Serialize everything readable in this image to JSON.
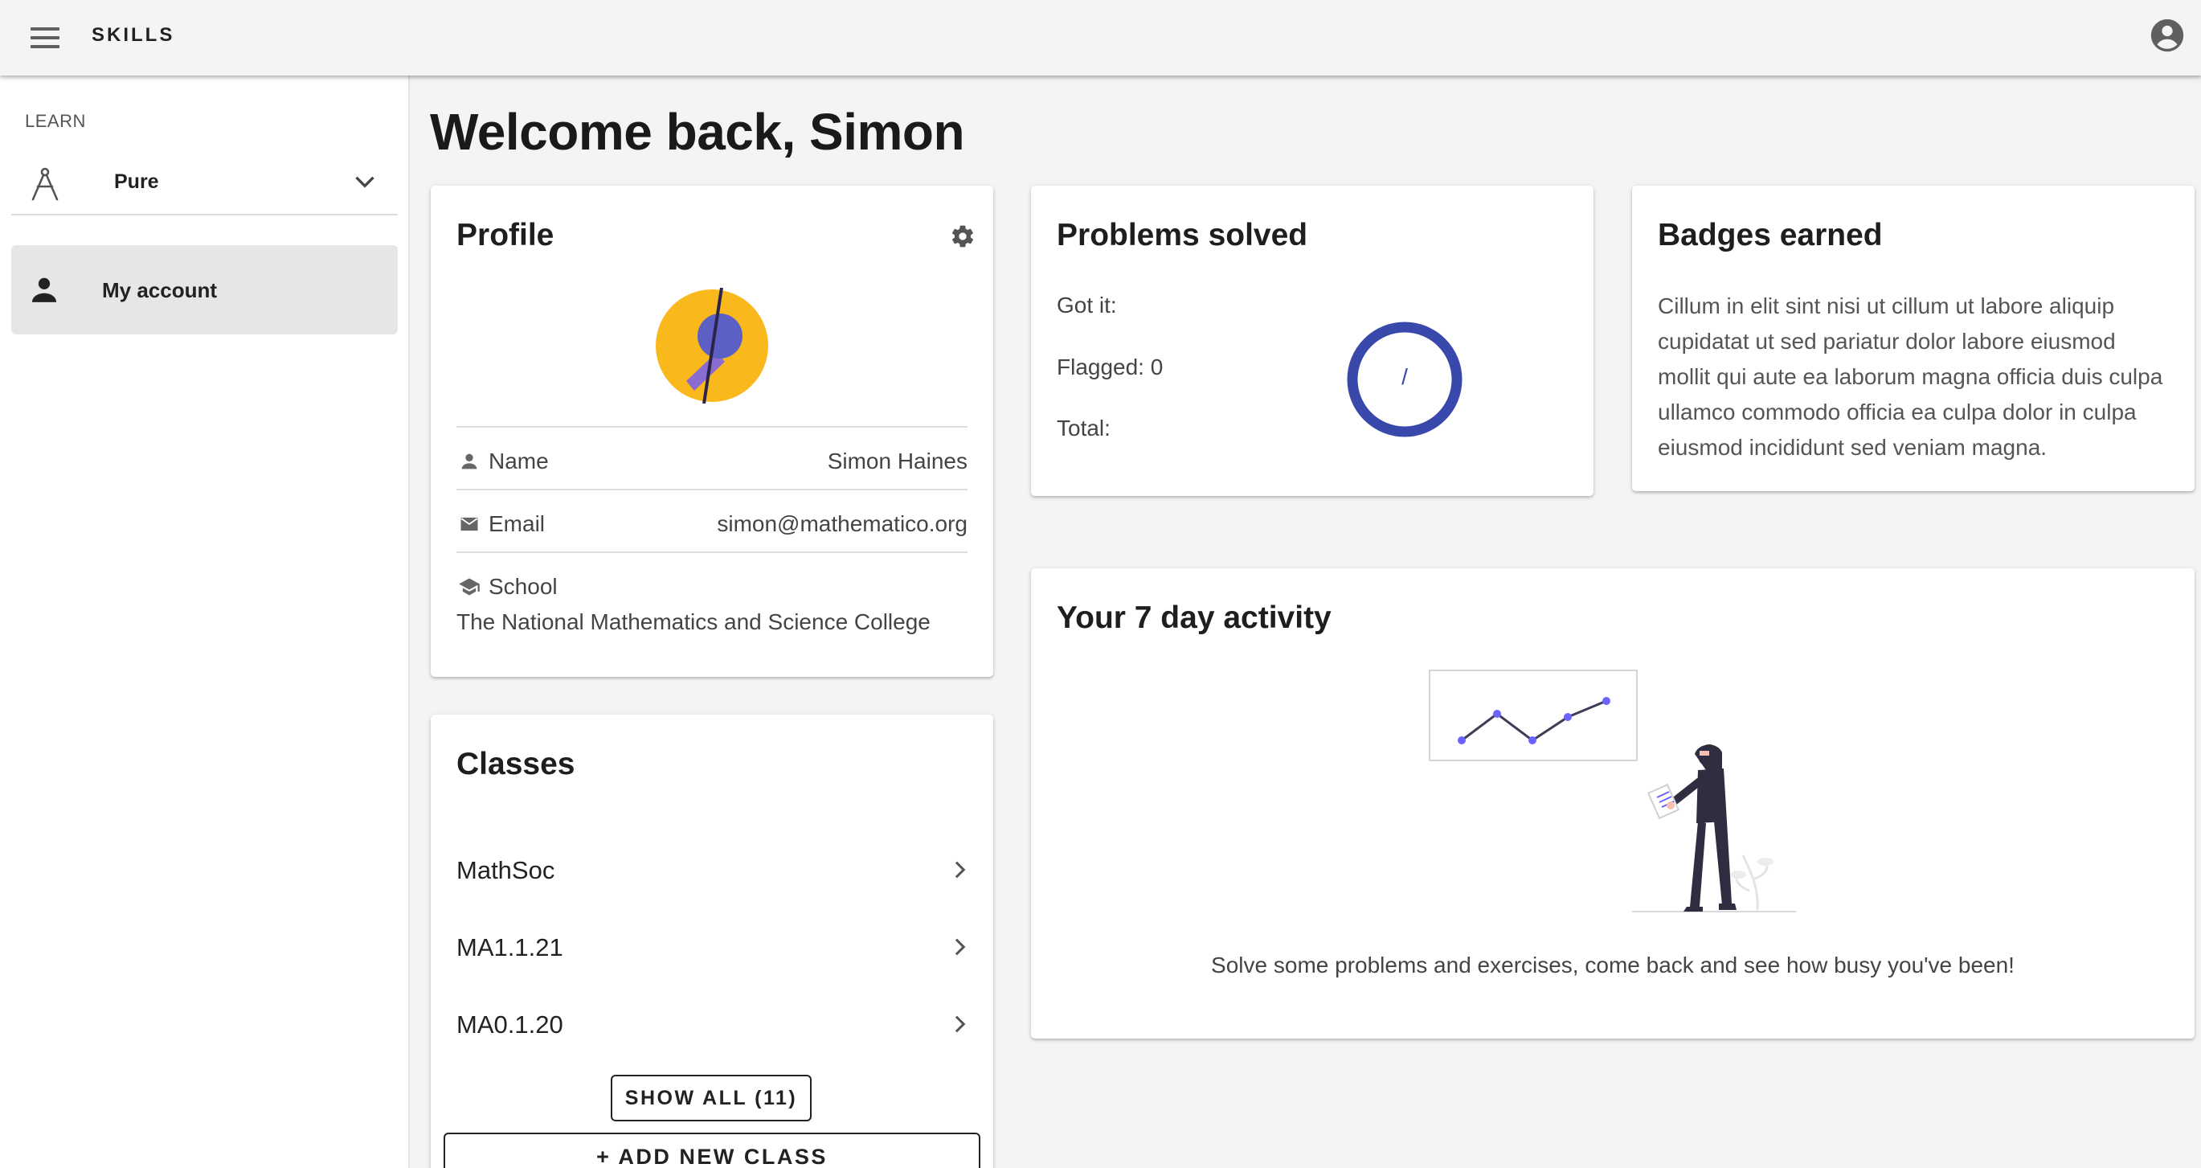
{
  "appbar": {
    "title": "SKILLS",
    "menu_icon": "menu-icon",
    "account_icon": "account-circle-icon"
  },
  "sidebar": {
    "section_label": "LEARN",
    "course": {
      "name": "Pure",
      "icon": "compass-icon"
    },
    "items": [
      {
        "label": "My account",
        "icon": "person-icon",
        "active": true
      }
    ]
  },
  "main": {
    "welcome": "Welcome back, Simon"
  },
  "profile": {
    "title": "Profile",
    "name_label": "Name",
    "name_value": "Simon Haines",
    "email_label": "Email",
    "email_value": "simon@mathematico.org",
    "school_label": "School",
    "school_value": "The National Mathematics and Science College"
  },
  "classes": {
    "title": "Classes",
    "items": [
      "MathSoc",
      "MA1.1.21",
      "MA0.1.20"
    ],
    "show_all_label": "SHOW ALL (11)",
    "add_label": "ADD NEW CLASS"
  },
  "problems": {
    "title": "Problems solved",
    "got_it": "Got it:",
    "flagged": "Flagged: 0",
    "total": "Total:",
    "ring_label": "/"
  },
  "badges": {
    "title": "Badges earned",
    "text": "Cillum in elit sint nisi ut cillum ut labore aliquip cupidatat ut sed pariatur dolor labore eiusmod mollit qui aute ea laborum magna officia duis culpa ullamco commodo officia ea culpa dolor in culpa eiusmod incididunt sed veniam magna."
  },
  "activity": {
    "title": "Your 7 day activity",
    "message": "Solve some problems and exercises, come back and see how busy you've been!"
  },
  "colors": {
    "accent": "#3949ab",
    "avatar_yellow": "#f9b81b",
    "avatar_purple": "#5c5fc4",
    "illus_dot": "#6c63ff"
  }
}
